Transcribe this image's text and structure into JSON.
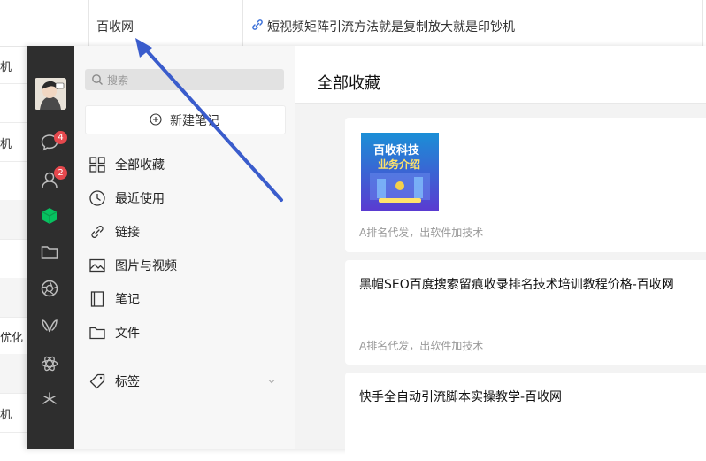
{
  "background_page": {
    "site_name": "百收网",
    "article_title": "短视频矩阵引流方法就是复制放大就是印钞机",
    "left_fragments": [
      "机",
      "机",
      "优化",
      "机"
    ]
  },
  "sidebar": {
    "chat_badge": "4",
    "contacts_badge": "2",
    "icons": [
      "chat-icon",
      "contacts-icon",
      "favorites-cube-icon",
      "folder-icon",
      "moments-aperture-icon",
      "mini-program-icon",
      "settings-hex-icon",
      "more-sparkle-icon"
    ]
  },
  "favorites_panel": {
    "search_placeholder": "搜索",
    "new_note_label": "新建笔记",
    "menu": [
      {
        "label": "全部收藏",
        "icon": "grid-icon"
      },
      {
        "label": "最近使用",
        "icon": "clock-icon"
      },
      {
        "label": "链接",
        "icon": "link-icon"
      },
      {
        "label": "图片与视频",
        "icon": "image-icon"
      },
      {
        "label": "笔记",
        "icon": "note-icon"
      },
      {
        "label": "文件",
        "icon": "folder-icon"
      }
    ],
    "tags_label": "标签"
  },
  "content": {
    "title": "全部收藏",
    "cards": [
      {
        "thumb_text_line1": "百收科技",
        "thumb_text_line2": "业务介绍",
        "meta": "A排名代发，出软件加技术"
      },
      {
        "title": "黑帽SEO百度搜索留痕收录排名技术培训教程价格-百收网",
        "meta": "A排名代发，出软件加技术"
      },
      {
        "title": "快手全自动引流脚本实操教学-百收网"
      }
    ]
  },
  "colors": {
    "sidebar_bg": "#2e2e2e",
    "accent_green": "#07c160",
    "badge_red": "#e5484d",
    "arrow_blue": "#3a5ccc"
  }
}
